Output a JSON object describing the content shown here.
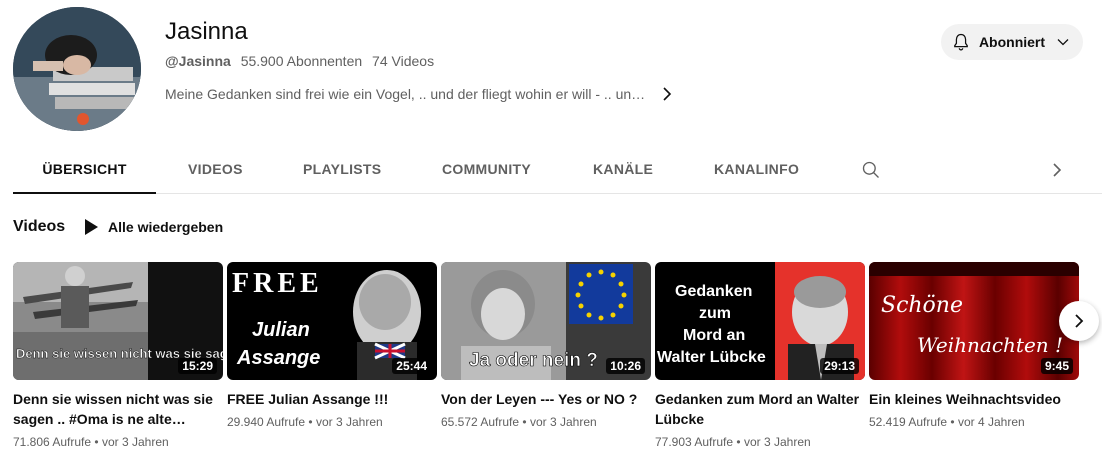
{
  "channel": {
    "name": "Jasinna",
    "handle": "@Jasinna",
    "subscribers": "55.900 Abonnenten",
    "video_count": "74 Videos",
    "description": "Meine Gedanken sind frei wie ein Vogel, .. und der fliegt wohin er will - .. un…",
    "subscribe_label": "Abonniert"
  },
  "tabs": [
    "ÜBERSICHT",
    "VIDEOS",
    "PLAYLISTS",
    "COMMUNITY",
    "KANÄLE",
    "KANALINFO"
  ],
  "section": {
    "title": "Videos",
    "play_all": "Alle wiedergeben"
  },
  "videos": [
    {
      "title": "Denn sie wissen nicht was sie sagen .. #Oma is ne alte…",
      "duration": "15:29",
      "views": "71.806 Aufrufe",
      "age": "vor 3 Jahren",
      "thumb_text": "Denn sie wissen nicht was sie sagen"
    },
    {
      "title": "FREE Julian Assange !!!",
      "duration": "25:44",
      "views": "29.940 Aufrufe",
      "age": "vor 3 Jahren",
      "thumb_text_1": "FREE",
      "thumb_text_2": "Julian",
      "thumb_text_3": "Assange"
    },
    {
      "title": "Von der Leyen --- Yes or NO ?",
      "duration": "10:26",
      "views": "65.572 Aufrufe",
      "age": "vor 3 Jahren",
      "thumb_text": "Ja oder nein ?"
    },
    {
      "title": "Gedanken zum Mord an Walter Lübcke",
      "duration": "29:13",
      "views": "77.903 Aufrufe",
      "age": "vor 3 Jahren",
      "thumb_text_1": "Gedanken",
      "thumb_text_2": "zum",
      "thumb_text_3": "Mord an",
      "thumb_text_4": "Walter Lübcke"
    },
    {
      "title": "Ein kleines Weihnachtsvideo",
      "duration": "9:45",
      "views": "52.419 Aufrufe",
      "age": "vor 4 Jahren",
      "thumb_text_1": "Schöne",
      "thumb_text_2": "Weihnachten !"
    }
  ],
  "meta_separator": "•",
  "icons": {
    "bell": "bell-icon",
    "chevron_down": "chevron-down-icon",
    "chevron_right": "chevron-right-icon",
    "search": "search-icon",
    "play": "play-icon"
  }
}
